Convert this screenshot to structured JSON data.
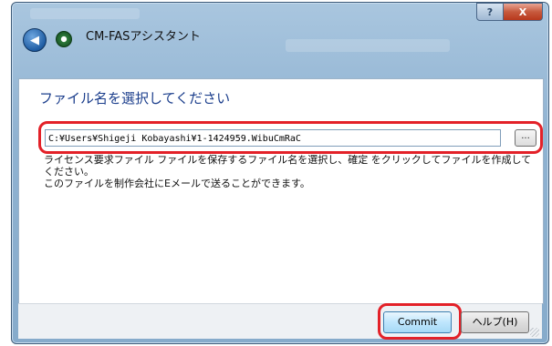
{
  "window": {
    "title": "CM-FASアシスタント",
    "help_button": "?",
    "close_button": "X"
  },
  "nav": {
    "back_icon": "back-arrow-icon",
    "app_icon": "cm-fas-app-icon"
  },
  "main": {
    "heading": "ファイル名を選択してください",
    "file_path": "C:¥Users¥Shigeji Kobayashi¥1-1424959.WibuCmRaC",
    "browse_label": "...",
    "description_line1": "ライセンス要求ファイル ファイルを保存するファイル名を選択し、確定 をクリックしてファイルを作成してください。",
    "description_line2": "このファイルを制作会社にEメールで送ることができます。"
  },
  "footer": {
    "commit_label": "Commit",
    "help_label": "ヘルプ(H)"
  },
  "colors": {
    "accent_heading": "#1b3e8c",
    "highlight": "#e32128",
    "title_bar": "#8fb2d1"
  }
}
